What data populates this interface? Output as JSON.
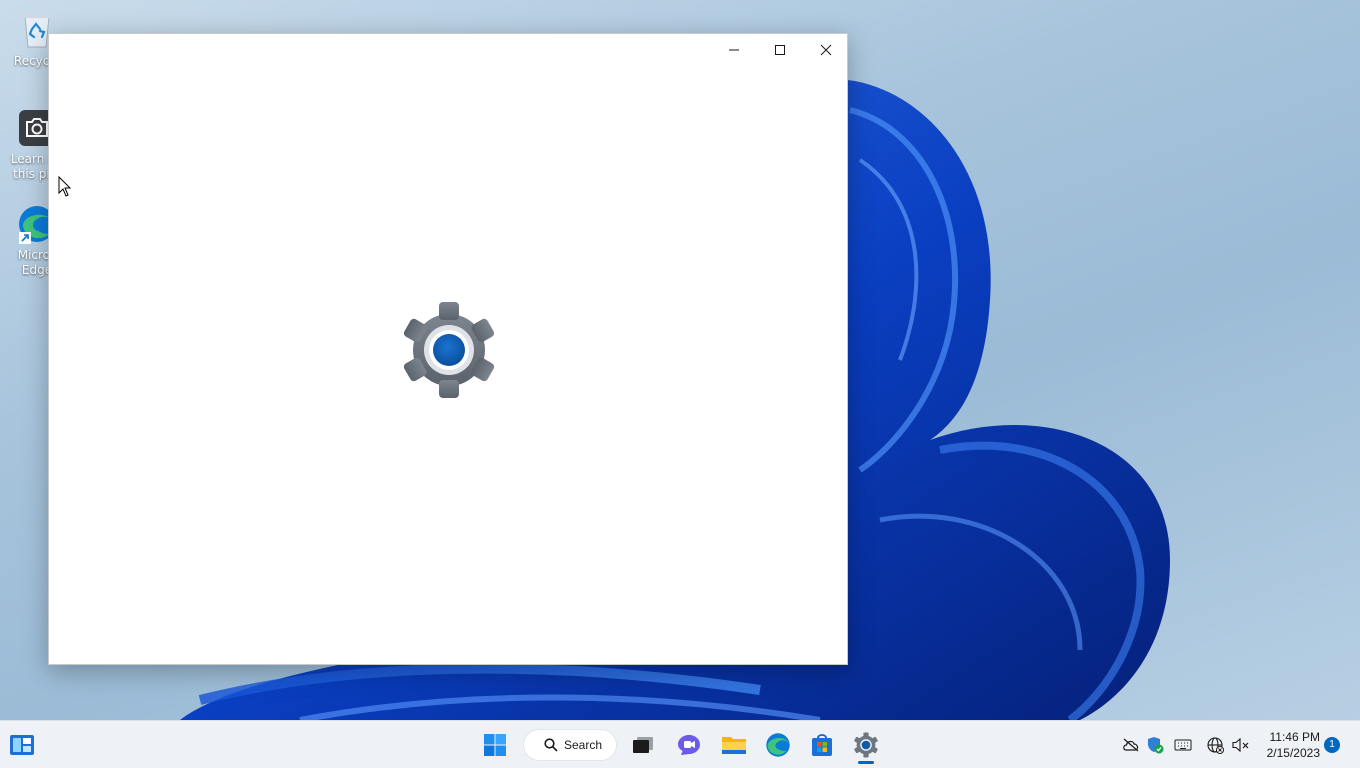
{
  "desktop": {
    "icons": [
      {
        "label_line1": "Recycle",
        "label_line2": "",
        "icon": "recycle-bin-icon"
      },
      {
        "label_line1": "Learn ab",
        "label_line2": "this pict",
        "icon": "camera-icon"
      },
      {
        "label_line1": "Micros",
        "label_line2": "Edge",
        "icon": "edge-icon"
      }
    ]
  },
  "window": {
    "title": "",
    "app_icon": "settings-gear-icon",
    "caption_buttons": [
      "minimize",
      "maximize",
      "close"
    ]
  },
  "taskbar": {
    "widgets_icon": "widgets-icon",
    "start_icon": "windows-start-icon",
    "search_label": "Search",
    "apps": [
      {
        "name": "task-view",
        "icon": "task-view-icon"
      },
      {
        "name": "chat",
        "icon": "chat-icon"
      },
      {
        "name": "file-explorer",
        "icon": "folder-icon"
      },
      {
        "name": "edge",
        "icon": "edge-icon"
      },
      {
        "name": "store",
        "icon": "store-icon"
      },
      {
        "name": "settings",
        "icon": "settings-gear-icon",
        "active": true
      }
    ],
    "tray": [
      "onedrive-icon",
      "security-icon",
      "keyboard-icon",
      "network-icon",
      "volume-muted-icon"
    ],
    "clock": {
      "time": "11:46 PM",
      "date": "2/15/2023"
    },
    "notification_count": "1"
  },
  "colors": {
    "accent": "#0067c0",
    "gear_gray": "#6e7680",
    "gear_blue": "#0f5ba8"
  }
}
